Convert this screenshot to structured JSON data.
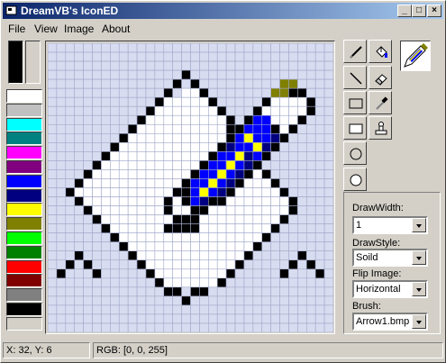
{
  "window": {
    "title": "DreamVB's IconED"
  },
  "menu": {
    "items": [
      "File",
      "View",
      "Image",
      "About"
    ]
  },
  "palette": {
    "primary_color": "#000000",
    "secondary_color": "#d4d0c8",
    "swatches": [
      "#ffffff",
      "#c0c0c0",
      "#00ffff",
      "#008080",
      "#ff00ff",
      "#800080",
      "#0000ff",
      "#000080",
      "#ffff00",
      "#808000",
      "#00ff00",
      "#008000",
      "#ff0000",
      "#800000",
      "#808080",
      "#000000",
      "#d4d0c8"
    ]
  },
  "tools": [
    {
      "name": "pencil-tool",
      "icon": "pencil-icon"
    },
    {
      "name": "fill-tool",
      "icon": "paint-bucket-icon"
    },
    {
      "name": "line-tool",
      "icon": "line-icon"
    },
    {
      "name": "eraser-tool",
      "icon": "eraser-icon"
    },
    {
      "name": "rectangle-tool",
      "icon": "rectangle-outline-icon"
    },
    {
      "name": "color-picker-tool",
      "icon": "eyedropper-icon"
    },
    {
      "name": "filled-rectangle-tool",
      "icon": "rectangle-filled-icon"
    },
    {
      "name": "stamp-tool",
      "icon": "stamp-icon"
    },
    {
      "name": "ellipse-tool",
      "icon": "ellipse-outline-icon"
    },
    {
      "name": "filled-ellipse-tool",
      "icon": "ellipse-filled-icon"
    }
  ],
  "options": {
    "draw_width_label": "DrawWidth:",
    "draw_width_value": "1",
    "draw_style_label": "DrawStyle:",
    "draw_style_value": "Soild",
    "flip_label": "Flip Image:",
    "flip_value": "Horizontal",
    "brush_label": "Brush:",
    "brush_value": "Arrow1.bmp"
  },
  "status": {
    "coords": "X: 32, Y: 6",
    "rgb": "RGB: [0, 0, 255]"
  },
  "icon_grid": {
    "size": 32,
    "background": "#ffffff",
    "gridline_color": "#a0a8c8",
    "empty_color": "#d8dcf0",
    "colors": {
      "k": "#000000",
      "w": "#ffffff",
      "b": "#0000ff",
      "n": "#000080",
      "y": "#ffff00",
      "o": "#808000"
    },
    "rows": [
      "................................",
      "................................",
      "................................",
      "...............k................",
      "..............k.k.........oo....",
      ".............k.wwk.......ookk...",
      "............kwwwwwk.....kwwwwk..",
      "...........kwwwwwwwk...kwwwwwk..",
      "..........kwwwwwwwwwk.kbbwwwk...",
      ".........kwwwwwwwwwwkkbbbkwk....",
      "........kwwwwwwwwwwwkbybbnk.....",
      ".......kwwwwwwwwwwwknbbynk......",
      "......kwwwwwwwwwwwkbbynbk.......",
      ".....kwwwwwwwwwwwkbbybnk........",
      "....kwwwwwwwwwwwkbbybnkwk.......",
      "...kwwwwwwwwwwwkbbybnkwwwk......",
      "..kwwwwwwwwwwwkkbybnkwwwwwk.....",
      "...kwwwwwwwwwkwkbnkkwwwwwwwk....",
      "....kwwwwwwwwkwwkkwwwwwwwwwk....",
      ".....kwwwwwwwwkkkwwwwwwwwwk.....",
      "......kwwwwwwkkkkwwwwwwwwk......",
      ".......kwwwwwwwwwwwwwwwwk.......",
      "........kwwwwwwwwwwwwwwk........",
      "...k.....kwwwwwwwwwwwwk.....k...",
      "..k.k.....kwwwwwwwwwwk.....k.k..",
      ".k...k.....kwwwwwwwwk.....k...k.",
      "............kwwwwwwk............",
      ".............kk.kk..............",
      "...............k................",
      "................................",
      "................................",
      "................................"
    ]
  }
}
